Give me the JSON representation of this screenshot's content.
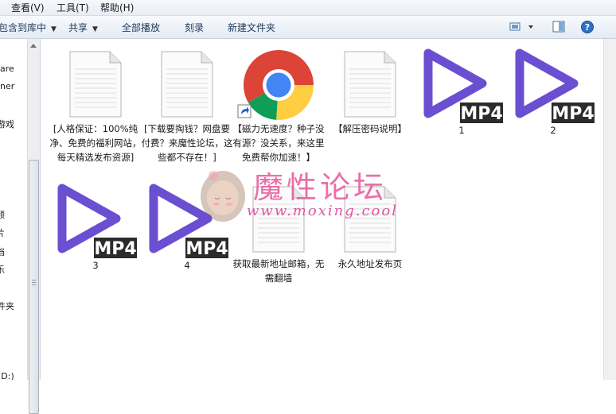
{
  "menubar": {
    "items": [
      "查看(V)",
      "工具(T)",
      "帮助(H)"
    ]
  },
  "toolbar": {
    "include_library": "包含到库中",
    "share": "共享",
    "play_all": "全部播放",
    "burn": "刻录",
    "new_folder": "新建文件夹"
  },
  "nav": {
    "items": [
      "are",
      "ner",
      "游戏",
      "频",
      "片",
      "档",
      "乐",
      "件夹",
      "(D:)"
    ]
  },
  "files": [
    {
      "type": "document",
      "label": "[人格保证：100%纯净、免费的福利网站，每天精选发布资源]"
    },
    {
      "type": "document",
      "label": "[下载要掏钱？网盘要付费？来魔性论坛，这些都不存在！]"
    },
    {
      "type": "shortcut",
      "icon": "chrome-icon",
      "label": "【磁力无速度？种子没有源？没关系，来这里免费帮你加速！】"
    },
    {
      "type": "document",
      "label": "【解压密码说明】"
    },
    {
      "type": "video",
      "badge": "MP4",
      "label": "1"
    },
    {
      "type": "video",
      "badge": "MP4",
      "label": "2"
    },
    {
      "type": "video",
      "badge": "MP4",
      "label": "3"
    },
    {
      "type": "video",
      "badge": "MP4",
      "label": "4"
    },
    {
      "type": "document",
      "label": "获取最新地址邮箱，无需翻墙"
    },
    {
      "type": "document",
      "label": "永久地址发布页"
    }
  ],
  "watermark": {
    "title": "魔性论坛",
    "url": "www.moxing.cool"
  },
  "colors": {
    "video_play": "#6a4fd1",
    "badge_bg": "#2b2b2b",
    "watermark": "#e8579a"
  }
}
